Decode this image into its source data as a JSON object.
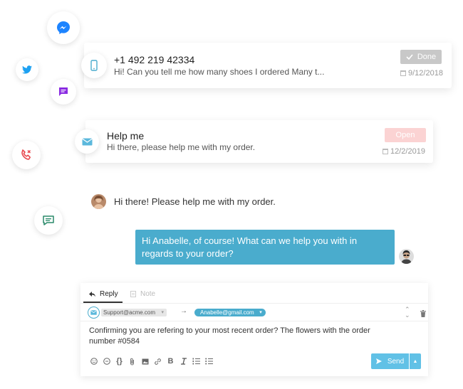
{
  "conversations": [
    {
      "title": "+1 492 219 42334",
      "preview": "Hi! Can you tell me how many shoes I ordered Many t...",
      "status_label": "Done",
      "date": "9/12/2018",
      "channel_icon": "phone-icon"
    },
    {
      "title": "Help me",
      "preview": "Hi there, please help me with my order.",
      "status_label": "Open",
      "date": "12/2/2019",
      "channel_icon": "email-icon"
    }
  ],
  "channels": [
    "messenger-icon",
    "twitter-icon",
    "chat-bubble-icon",
    "phone-call-icon",
    "sms-icon"
  ],
  "chat": {
    "incoming": "Hi there! Please help me with my order.",
    "outgoing": "Hi Anabelle, of course! What can we help you with in regards to your order?"
  },
  "composer": {
    "tab_reply": "Reply",
    "tab_note": "Note",
    "from": "Support@acme.com",
    "to": "Anabelle@gmail.com",
    "body": "Confirming you are refering to your most recent order? The flowers with the order number #0584",
    "send_label": "Send"
  },
  "colors": {
    "accent": "#4aaccd",
    "send": "#61c1e6",
    "messenger": "#1d84ff",
    "twitter": "#1da1f2",
    "chat_purple": "#8a2be2",
    "phone_red": "#e8474d",
    "sms_green": "#2a8a6a",
    "open_badge": "#fbd3d3",
    "done_badge": "#c8c8c8"
  }
}
